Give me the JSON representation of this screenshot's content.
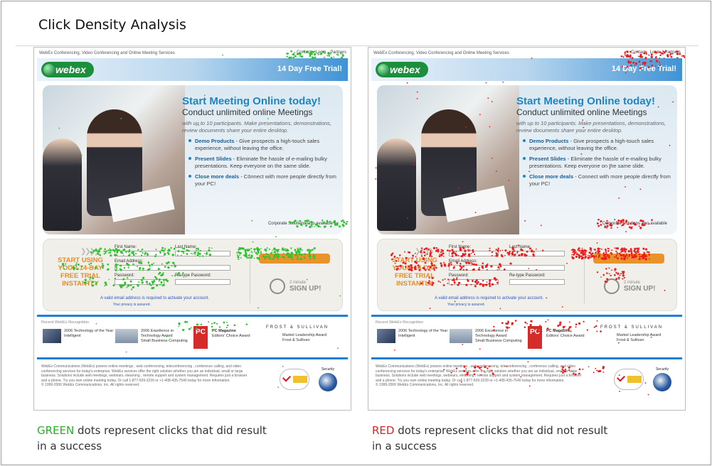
{
  "page_title": "Click Density Analysis",
  "panels": [
    {
      "id": "left",
      "dot_color": "#2fc22f",
      "site": {
        "topnav_left": "WebEx Conferencing, Video Conferencing and Online Meeting Services",
        "topnav_links": [
          "Contact",
          "Login",
          "Partners"
        ],
        "logo": "webex",
        "trial_banner": "14 Day Free Trial!",
        "headline": "Start Meeting Online today!",
        "subheadline": "Conduct unlimited online Meetings",
        "tagline": "with up to 10 participants. Make presentations, demonstrations, review documents share your entire desktop.",
        "bullets": [
          {
            "title": "Demo Products",
            "text": " - Give prospects a high-touch sales experience, without leaving the office."
          },
          {
            "title": "Present Slides",
            "text": " - Eliminate the hassle of e-mailing bulky presentations. Keep everyone on the same slide."
          },
          {
            "title": "Close more deals",
            "text": " - Connect with more people directly from your PC!"
          }
        ],
        "corporate": "Corporate Solutions also available",
        "start_text": "START USING YOUR 14-DAY FREE TRIAL INSTANTLY",
        "first_name": "First Name:",
        "last_name": "Last Name:",
        "email": "Email Address:",
        "password": "Password:",
        "retype": "Re-type Password:",
        "email_note": "A valid email address is required to activate your account.",
        "privacy_note": "Your privacy is assured.",
        "signup_minute": "2 minute",
        "signup": "SIGN UP!",
        "recognition": "Recent WebEx Recognition",
        "award1": "2006 Technology of the Year",
        "award1_sub": "Intelligent",
        "award2": "2006 Excellence in Technology Award",
        "award2_sub": "Small Business Computing",
        "award3": "PC Magazine",
        "award3_sub": "Editors' Choice Award",
        "award4": "FROST & SULLIVAN",
        "award4_sub": "Market Leadership Award",
        "award4_sub2": "Frost & Sullivan",
        "footer": "WebEx Communications (WebEx) powers online meetings , web conferencing, teleconferencing , conference calling, and video conferencing services for today's enterprise. WebEx services offer the right solution whether you are an individual, small or large business. Solutions include web meetings, webinars, elearning , remote support and system management. Requires just a browser and a phone. Try you own online meeting today. Or call 1-877-509-3239 or +1-408-435-7540 today for more information.",
        "copyright": "© 1999-2006 WebEx Communications, Inc. All rights reserved.",
        "verisign": "VeriSign Secured",
        "security": "Security"
      },
      "caption_colored": "GREEN",
      "caption_rest": " dots represent clicks that did result",
      "caption_line2": " in a success"
    },
    {
      "id": "right",
      "dot_color": "#ee1d1d",
      "site": {
        "topnav_left": "WebEx Conferencing, Video Conferencing and Online Meeting Services",
        "topnav_links": [
          "Contact",
          "Login",
          "Partners"
        ],
        "logo": "webex",
        "trial_banner": "14 Day Free Trial!",
        "headline": "Start Meeting Online today!",
        "subheadline": "Conduct unlimited online Meetings",
        "tagline": "with up to 10 participants. Make presentations, demonstrations, review documents share your entire desktop.",
        "bullets": [
          {
            "title": "Demo Products",
            "text": " - Give prospects a high-touch sales experience, without leaving the office."
          },
          {
            "title": "Present Slides",
            "text": " - Eliminate the hassle of e-mailing bulky presentations. Keep everyone on the same slide."
          },
          {
            "title": "Close more deals",
            "text": " - Connect with more people directly from your PC!"
          }
        ],
        "corporate": "Corporate Solutions also available",
        "start_text": "START USING YOUR 14-DAY FREE TRIAL INSTANTLY",
        "first_name": "First Name:",
        "last_name": "Last Name:",
        "email": "Email Address:",
        "password": "Password:",
        "retype": "Re-type Password:",
        "email_note": "A valid email address is required to activate your account.",
        "privacy_note": "Your privacy is assured.",
        "signup_minute": "2 minute",
        "signup": "SIGN UP!",
        "recognition": "Recent WebEx Recognition",
        "award1": "2006 Technology of the Year",
        "award1_sub": "Intelligent",
        "award2": "2006 Excellence in Technology Award",
        "award2_sub": "Small Business Computing",
        "award3": "PC Magazine",
        "award3_sub": "Editors' Choice Award",
        "award4": "FROST & SULLIVAN",
        "award4_sub": "Market Leadership Award",
        "award4_sub2": "Frost & Sullivan",
        "footer": "WebEx Communications (WebEx) powers online meetings , web conferencing, teleconferencing , conference calling, and video conferencing services for today's enterprise. WebEx services offer the right solution whether you are an individual, small or large business. Solutions include web meetings, webinars, elearning , remote support and system management. Requires just a browser and a phone. Try you own online meeting today. Or call 1-877-509-3239 or +1-408-435-7540 today for more information.",
        "copyright": "© 1999-2006 WebEx Communications, Inc. All rights reserved.",
        "verisign": "VeriSign Secured",
        "security": "Security"
      },
      "caption_colored": "RED",
      "caption_rest": " dots represent clicks that did not result",
      "caption_line2": " in a success"
    }
  ]
}
